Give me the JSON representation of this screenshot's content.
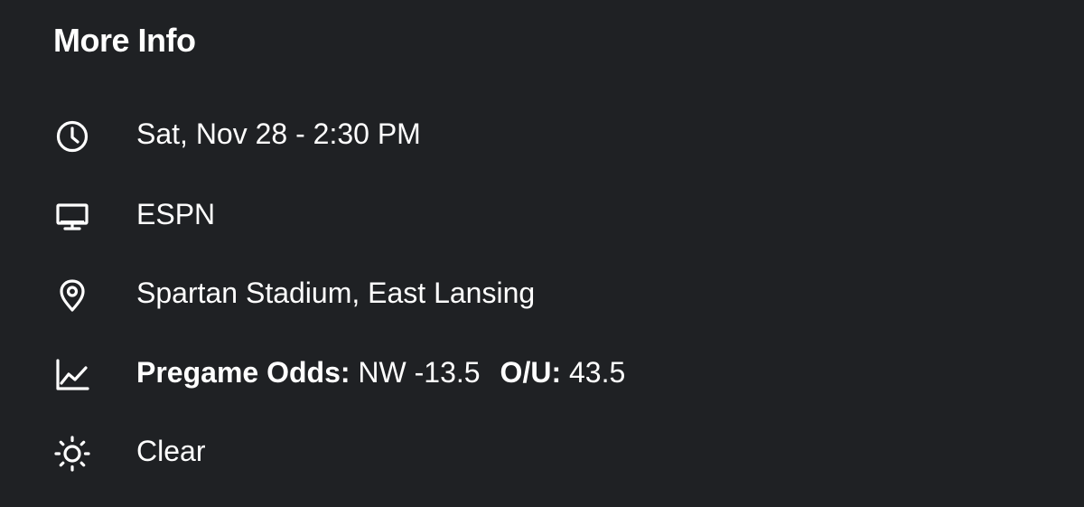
{
  "section": {
    "title": "More Info"
  },
  "rows": {
    "time": {
      "icon": "clock-icon",
      "text": "Sat, Nov 28 - 2:30 PM"
    },
    "network": {
      "icon": "tv-icon",
      "text": "ESPN"
    },
    "venue": {
      "icon": "location-pin-icon",
      "text": "Spartan Stadium, East Lansing"
    },
    "odds": {
      "icon": "trend-chart-icon",
      "label": "Pregame Odds:",
      "spread": "NW -13.5",
      "ou_label": "O/U:",
      "ou_value": "43.5"
    },
    "weather": {
      "icon": "sun-icon",
      "text": "Clear"
    }
  },
  "colors": {
    "background": "#1f2124",
    "text": "#ffffff"
  }
}
